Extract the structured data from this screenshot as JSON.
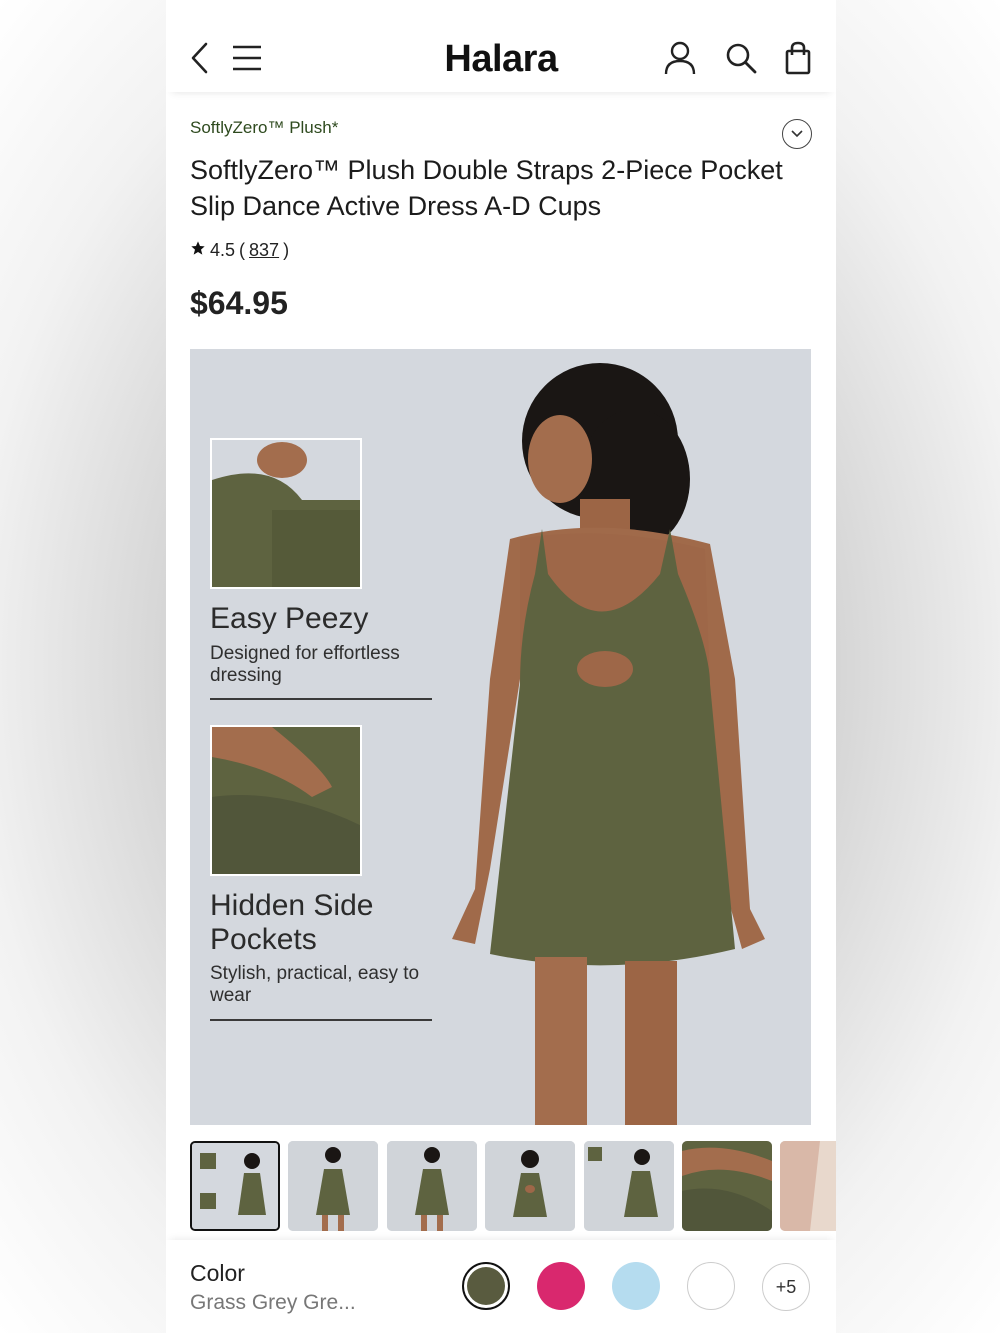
{
  "header": {
    "logo": "Halara",
    "icons": [
      "back-arrow-icon",
      "menu-icon",
      "account-icon",
      "search-icon",
      "shopping-bag-icon"
    ]
  },
  "product": {
    "brand": "SoftlyZero™ Plush*",
    "title": "SoftlyZero™ Plush Double Straps 2-Piece Pocket Slip Dance Active Dress A-D Cups",
    "rating": "4.5",
    "rating_open": "(",
    "review_count": "837",
    "rating_close": ")",
    "price": "$64.95"
  },
  "hero": {
    "features": [
      {
        "title": "Easy Peezy",
        "desc": "Designed for effortless dressing"
      },
      {
        "title": "Hidden Side Pockets",
        "desc": "Stylish, practical, easy to wear"
      }
    ]
  },
  "thumbnails_count": 7,
  "color": {
    "label": "Color",
    "value": "Grass Grey Gre...",
    "swatches": [
      "#595b3f",
      "#d9286e",
      "#b5dcef",
      "#ffffff"
    ],
    "more_label": "+5"
  },
  "colors": {
    "dress": "#5e6340",
    "hero_bg": "#d4d8de",
    "brand_text": "#2e4a1e"
  }
}
